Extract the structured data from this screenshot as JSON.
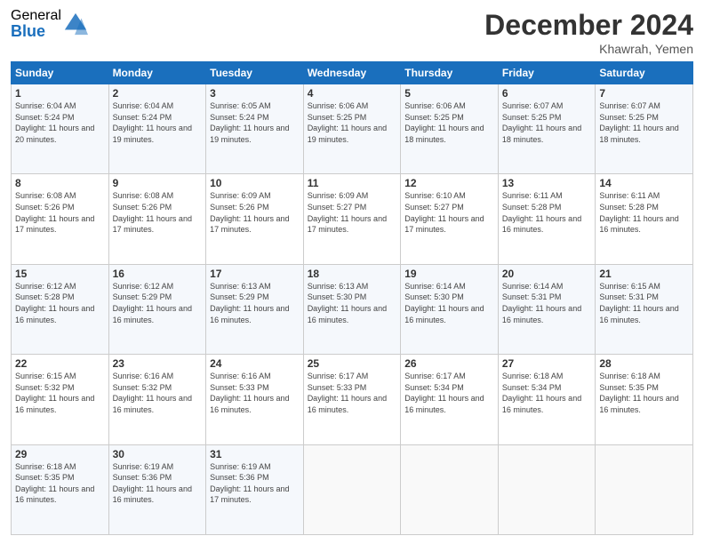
{
  "logo": {
    "general": "General",
    "blue": "Blue"
  },
  "title": "December 2024",
  "location": "Khawrah, Yemen",
  "days_header": [
    "Sunday",
    "Monday",
    "Tuesday",
    "Wednesday",
    "Thursday",
    "Friday",
    "Saturday"
  ],
  "weeks": [
    [
      {
        "num": "1",
        "rise": "6:04 AM",
        "set": "5:24 PM",
        "daylight": "11 hours and 20 minutes."
      },
      {
        "num": "2",
        "rise": "6:04 AM",
        "set": "5:24 PM",
        "daylight": "11 hours and 19 minutes."
      },
      {
        "num": "3",
        "rise": "6:05 AM",
        "set": "5:24 PM",
        "daylight": "11 hours and 19 minutes."
      },
      {
        "num": "4",
        "rise": "6:06 AM",
        "set": "5:25 PM",
        "daylight": "11 hours and 19 minutes."
      },
      {
        "num": "5",
        "rise": "6:06 AM",
        "set": "5:25 PM",
        "daylight": "11 hours and 18 minutes."
      },
      {
        "num": "6",
        "rise": "6:07 AM",
        "set": "5:25 PM",
        "daylight": "11 hours and 18 minutes."
      },
      {
        "num": "7",
        "rise": "6:07 AM",
        "set": "5:25 PM",
        "daylight": "11 hours and 18 minutes."
      }
    ],
    [
      {
        "num": "8",
        "rise": "6:08 AM",
        "set": "5:26 PM",
        "daylight": "11 hours and 17 minutes."
      },
      {
        "num": "9",
        "rise": "6:08 AM",
        "set": "5:26 PM",
        "daylight": "11 hours and 17 minutes."
      },
      {
        "num": "10",
        "rise": "6:09 AM",
        "set": "5:26 PM",
        "daylight": "11 hours and 17 minutes."
      },
      {
        "num": "11",
        "rise": "6:09 AM",
        "set": "5:27 PM",
        "daylight": "11 hours and 17 minutes."
      },
      {
        "num": "12",
        "rise": "6:10 AM",
        "set": "5:27 PM",
        "daylight": "11 hours and 17 minutes."
      },
      {
        "num": "13",
        "rise": "6:11 AM",
        "set": "5:28 PM",
        "daylight": "11 hours and 16 minutes."
      },
      {
        "num": "14",
        "rise": "6:11 AM",
        "set": "5:28 PM",
        "daylight": "11 hours and 16 minutes."
      }
    ],
    [
      {
        "num": "15",
        "rise": "6:12 AM",
        "set": "5:28 PM",
        "daylight": "11 hours and 16 minutes."
      },
      {
        "num": "16",
        "rise": "6:12 AM",
        "set": "5:29 PM",
        "daylight": "11 hours and 16 minutes."
      },
      {
        "num": "17",
        "rise": "6:13 AM",
        "set": "5:29 PM",
        "daylight": "11 hours and 16 minutes."
      },
      {
        "num": "18",
        "rise": "6:13 AM",
        "set": "5:30 PM",
        "daylight": "11 hours and 16 minutes."
      },
      {
        "num": "19",
        "rise": "6:14 AM",
        "set": "5:30 PM",
        "daylight": "11 hours and 16 minutes."
      },
      {
        "num": "20",
        "rise": "6:14 AM",
        "set": "5:31 PM",
        "daylight": "11 hours and 16 minutes."
      },
      {
        "num": "21",
        "rise": "6:15 AM",
        "set": "5:31 PM",
        "daylight": "11 hours and 16 minutes."
      }
    ],
    [
      {
        "num": "22",
        "rise": "6:15 AM",
        "set": "5:32 PM",
        "daylight": "11 hours and 16 minutes."
      },
      {
        "num": "23",
        "rise": "6:16 AM",
        "set": "5:32 PM",
        "daylight": "11 hours and 16 minutes."
      },
      {
        "num": "24",
        "rise": "6:16 AM",
        "set": "5:33 PM",
        "daylight": "11 hours and 16 minutes."
      },
      {
        "num": "25",
        "rise": "6:17 AM",
        "set": "5:33 PM",
        "daylight": "11 hours and 16 minutes."
      },
      {
        "num": "26",
        "rise": "6:17 AM",
        "set": "5:34 PM",
        "daylight": "11 hours and 16 minutes."
      },
      {
        "num": "27",
        "rise": "6:18 AM",
        "set": "5:34 PM",
        "daylight": "11 hours and 16 minutes."
      },
      {
        "num": "28",
        "rise": "6:18 AM",
        "set": "5:35 PM",
        "daylight": "11 hours and 16 minutes."
      }
    ],
    [
      {
        "num": "29",
        "rise": "6:18 AM",
        "set": "5:35 PM",
        "daylight": "11 hours and 16 minutes."
      },
      {
        "num": "30",
        "rise": "6:19 AM",
        "set": "5:36 PM",
        "daylight": "11 hours and 16 minutes."
      },
      {
        "num": "31",
        "rise": "6:19 AM",
        "set": "5:36 PM",
        "daylight": "11 hours and 17 minutes."
      },
      null,
      null,
      null,
      null
    ]
  ]
}
